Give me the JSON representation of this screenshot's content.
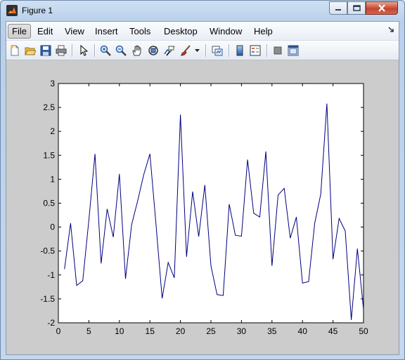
{
  "window": {
    "title": "Figure 1"
  },
  "menu": {
    "items": [
      {
        "label": "File",
        "name": "menu-file"
      },
      {
        "label": "Edit",
        "name": "menu-edit"
      },
      {
        "label": "View",
        "name": "menu-view"
      },
      {
        "label": "Insert",
        "name": "menu-insert"
      },
      {
        "label": "Tools",
        "name": "menu-tools"
      },
      {
        "label": "Desktop",
        "name": "menu-desktop"
      },
      {
        "label": "Window",
        "name": "menu-window"
      },
      {
        "label": "Help",
        "name": "menu-help"
      }
    ]
  },
  "toolbar": {
    "icons": [
      "new-figure-icon",
      "open-file-icon",
      "save-icon",
      "print-icon",
      "edit-plot-icon",
      "zoom-in-icon",
      "zoom-out-icon",
      "pan-icon",
      "rotate-3d-icon",
      "data-cursor-icon",
      "brush-icon",
      "link-plot-icon",
      "colorbar-icon",
      "legend-icon",
      "hide-plot-tools-icon",
      "show-plot-tools-icon"
    ]
  },
  "colors": {
    "line": "#00007f",
    "figure_bg": "#cccccc",
    "axes_bg": "#ffffff"
  },
  "chart_data": {
    "type": "line",
    "title": "",
    "xlabel": "",
    "ylabel": "",
    "xlim": [
      0,
      50
    ],
    "ylim": [
      -2,
      3
    ],
    "xticks": [
      "0",
      "5",
      "10",
      "15",
      "20",
      "25",
      "30",
      "35",
      "40",
      "45",
      "50"
    ],
    "yticks": [
      "-2",
      "-1.5",
      "-1",
      "-0.5",
      "0",
      "0.5",
      "1",
      "1.5",
      "2",
      "2.5",
      "3"
    ],
    "grid": false,
    "series": [
      {
        "x": [
          1,
          2,
          3,
          4,
          5,
          6,
          7,
          8,
          9,
          10,
          11,
          12,
          13,
          14,
          15,
          16,
          17,
          18,
          19,
          20,
          21,
          22,
          23,
          24,
          25,
          26,
          27,
          28,
          29,
          30,
          31,
          32,
          33,
          34,
          35,
          36,
          37,
          38,
          39,
          40,
          41,
          42,
          43,
          44,
          45,
          46,
          47,
          48,
          49,
          50
        ],
        "values": [
          -0.88,
          0.08,
          -1.22,
          -1.12,
          0.15,
          1.53,
          -0.76,
          0.38,
          -0.21,
          1.11,
          -1.08,
          0.05,
          0.55,
          1.1,
          1.53,
          0.05,
          -1.49,
          -0.74,
          -1.06,
          2.35,
          -0.62,
          0.74,
          -0.2,
          0.88,
          -0.81,
          -1.41,
          -1.43,
          0.48,
          -0.17,
          -0.19,
          1.41,
          0.29,
          0.21,
          1.58,
          -0.81,
          0.67,
          0.81,
          -0.23,
          0.21,
          -1.17,
          -1.14,
          0.08,
          0.69,
          2.58,
          -0.67,
          0.18,
          -0.08,
          -1.94,
          -0.45,
          -1.72
        ]
      }
    ]
  }
}
